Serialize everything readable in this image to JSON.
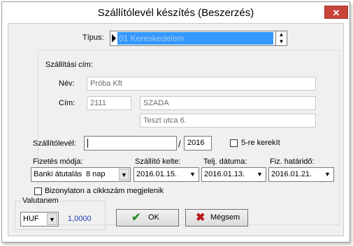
{
  "window": {
    "title": "Szállítólevél készítés (Beszerzés)",
    "close_glyph": "✕"
  },
  "tipus": {
    "label": "Típus:",
    "value": "01 Kereskedelem"
  },
  "address": {
    "section_label": "Szállítási cím:",
    "name_label": "Név:",
    "name_value": "Próba Kft",
    "address_label": "Cím:",
    "zip_value": "2111",
    "city_value": "SZADA",
    "street_value": "Teszt utca 6."
  },
  "delivery_note": {
    "label": "Szállítólevél:",
    "number_value": "",
    "separator": "/",
    "year_value": "2016",
    "round_label": "5-re kerekít"
  },
  "payment": {
    "method_label": "Fizetés módja:",
    "method_value": "Banki átutalás",
    "method_days": "8 nap",
    "issue_label": "Szállító kelte:",
    "issue_value": "2016.01.15.",
    "fulfil_label": "Telj. dátuma:",
    "fulfil_value": "2016.01.13.",
    "due_label": "Fiz. határidő:",
    "due_value": "2016.01.21."
  },
  "voucher_checkbox_label": "Bizonylaton a cikkszám megjelenik",
  "currency": {
    "group_label": "Valutanem",
    "value": "HUF",
    "rate": "1,0000"
  },
  "buttons": {
    "ok_label": "OK",
    "cancel_label": "Mégsem"
  },
  "colors": {
    "selection": "#3399ff",
    "rate_text": "#1f3fb4",
    "ok_icon": "#2e8b2e",
    "cancel_icon": "#b81818"
  },
  "icons": {
    "ok": "check-icon",
    "cancel": "x-icon",
    "pointer": "row-pointer-icon"
  }
}
